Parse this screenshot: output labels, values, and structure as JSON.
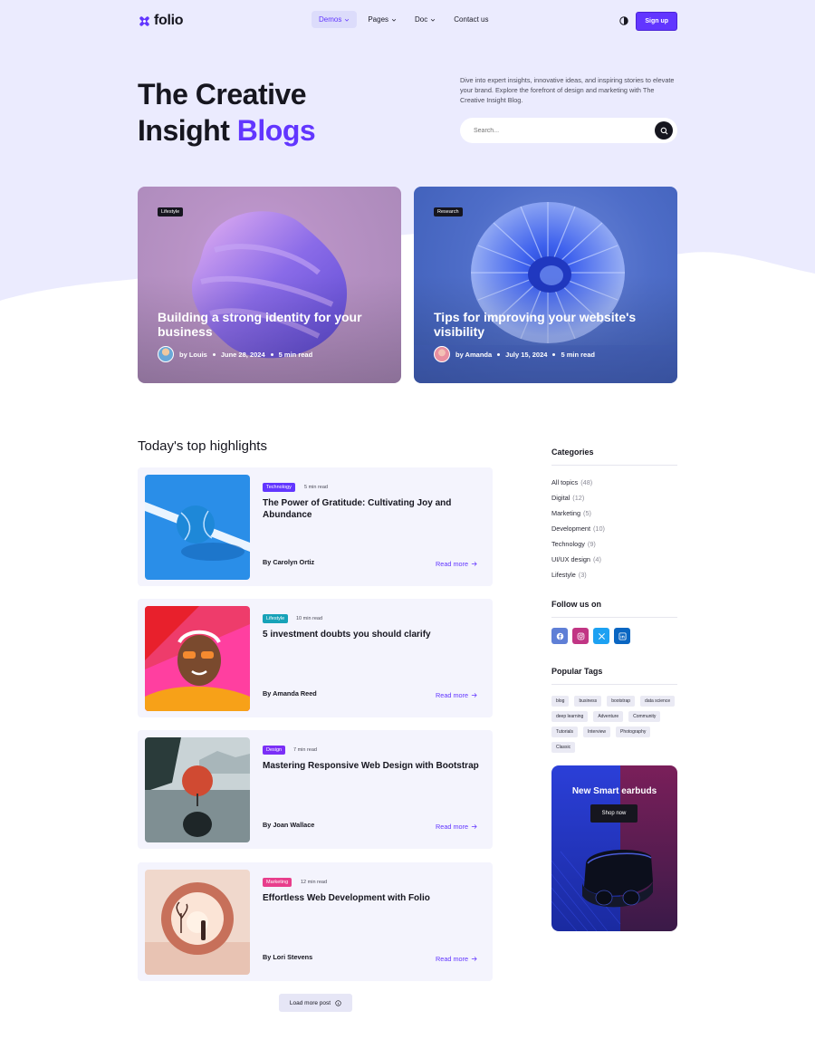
{
  "brand": {
    "name": "folio",
    "accent": "#6236ff"
  },
  "nav": {
    "items": [
      {
        "label": "Demos",
        "dropdown": true,
        "active": true
      },
      {
        "label": "Pages",
        "dropdown": true,
        "active": false
      },
      {
        "label": "Doc",
        "dropdown": true,
        "active": false
      },
      {
        "label": "Contact us",
        "dropdown": false,
        "active": false
      }
    ],
    "signup_label": "Sign up"
  },
  "hero": {
    "title_line1": "The Creative",
    "title_line2_prefix": "Insight",
    "title_line2_accent": "Blogs",
    "description": "Dive into expert insights, innovative ideas, and inspiring stories to elevate your brand. Explore the forefront of design and marketing with The Creative Insight Blog.",
    "search_placeholder": "Search..."
  },
  "featured": [
    {
      "badge": "Lifestyle",
      "title": "Building a strong identity for your business",
      "author": "by Louis",
      "date": "June 28, 2024",
      "read": "5 min read"
    },
    {
      "badge": "Research",
      "title": "Tips for improving your website's visibility",
      "author": "by Amanda",
      "date": "July 15, 2024",
      "read": "5 min read"
    }
  ],
  "highlights": {
    "title": "Today's top highlights",
    "posts": [
      {
        "badge": "Technology",
        "badge_color": "#6236ff",
        "read": "5 min read",
        "title": "The Power of Gratitude: Cultivating Joy and Abundance",
        "author": "By Carolyn Ortiz",
        "more": "Read more"
      },
      {
        "badge": "Lifestyle",
        "badge_color": "#17a2b8",
        "read": "10 min read",
        "title": "5 investment doubts you should clarify",
        "author": "By Amanda Reed",
        "more": "Read more"
      },
      {
        "badge": "Design",
        "badge_color": "#7b2ff7",
        "read": "7 min read",
        "title": "Mastering Responsive Web Design with Bootstrap",
        "author": "By Joan Wallace",
        "more": "Read more"
      },
      {
        "badge": "Marketing",
        "badge_color": "#e83e8c",
        "read": "12 min read",
        "title": "Effortless Web Development with Folio",
        "author": "By Lori Stevens",
        "more": "Read more"
      }
    ],
    "load_more": "Load more post"
  },
  "sidebar": {
    "categories_title": "Categories",
    "categories": [
      {
        "label": "All topics",
        "count": "(48)"
      },
      {
        "label": "Digital",
        "count": "(12)"
      },
      {
        "label": "Marketing",
        "count": "(5)"
      },
      {
        "label": "Development",
        "count": "(10)"
      },
      {
        "label": "Technology",
        "count": "(9)"
      },
      {
        "label": "UI/UX design",
        "count": "(4)"
      },
      {
        "label": "Lifestyle",
        "count": "(3)"
      }
    ],
    "follow_title": "Follow us on",
    "socials": [
      {
        "name": "facebook-icon",
        "color": "#5f7fd6"
      },
      {
        "name": "instagram-icon",
        "color": "#c13584"
      },
      {
        "name": "x-icon",
        "color": "#1da1f2"
      },
      {
        "name": "linkedin-icon",
        "color": "#0a66c2"
      }
    ],
    "tags_title": "Popular Tags",
    "tags": [
      "blog",
      "business",
      "bootstrap",
      "data science",
      "deep learning",
      "Adventure",
      "Community",
      "Tutorials",
      "Interview",
      "Photography",
      "Classic"
    ],
    "ad": {
      "title": "New Smart earbuds",
      "button": "Shop now"
    }
  }
}
